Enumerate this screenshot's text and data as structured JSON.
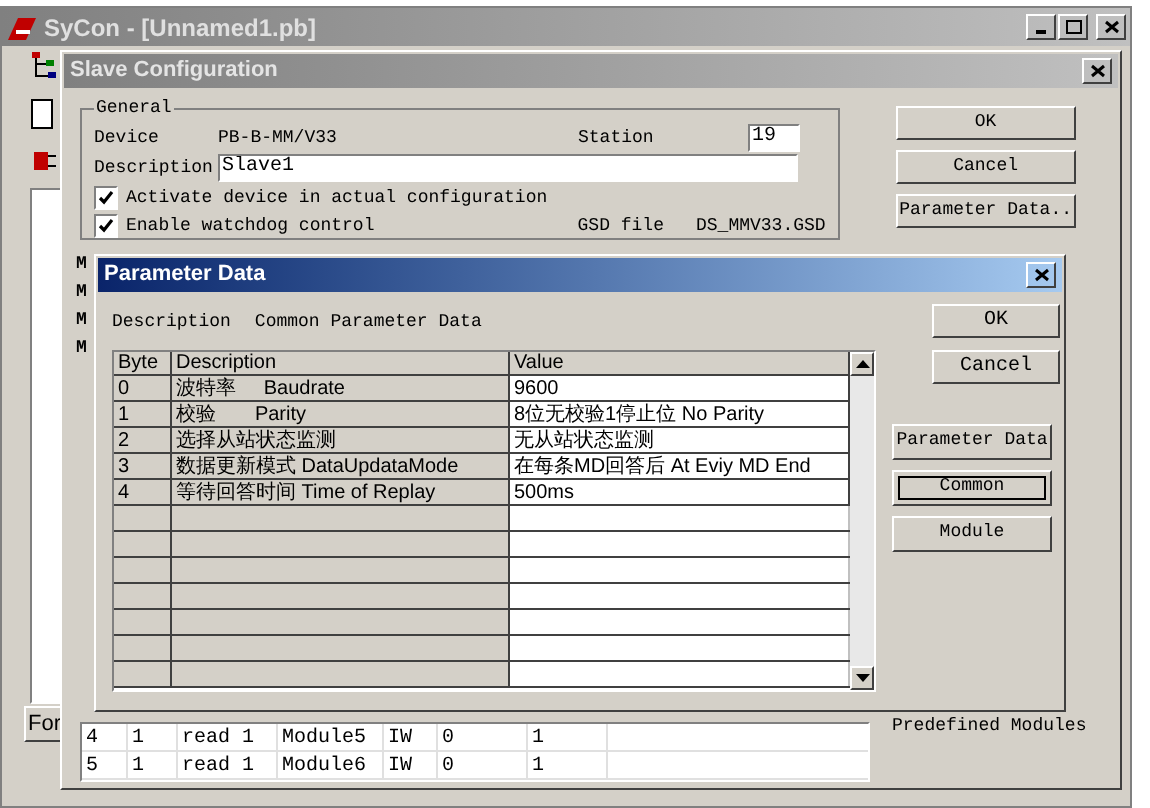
{
  "main_window": {
    "title": "SyCon - [Unnamed1.pb]",
    "tab": "For"
  },
  "slave_configuration": {
    "title": "Slave Configuration",
    "group": "General",
    "device_label": "Device",
    "device": "PB-B-MM/V33",
    "station_label": "Station",
    "station": "19",
    "description_label": "Description",
    "description": "Slave1",
    "options": [
      {
        "label": "Activate device in actual configuration",
        "checked": true
      },
      {
        "label": "Enable watchdog control",
        "checked": true
      }
    ],
    "gsd_label": "GSD file",
    "gsd_file": "DS_MMV33.GSD",
    "buttons": [
      "OK",
      "Cancel",
      "Parameter Data.."
    ],
    "side_labels": [
      "M",
      "M",
      "M",
      "M"
    ],
    "module_rows": [
      [
        "4",
        "1",
        "read 1",
        "Module5",
        "IW",
        "0",
        "1"
      ],
      [
        "5",
        "1",
        "read 1",
        "Module6",
        "IW",
        "0",
        "1"
      ]
    ],
    "predefined_label": "Predefined Modules"
  },
  "parameter_data": {
    "title": "Parameter Data",
    "description_label": "Description",
    "description": "Common Parameter Data",
    "columns": [
      "Byte",
      "Description",
      "Value"
    ],
    "rows": [
      [
        "0",
        "波特率     Baudrate",
        "9600"
      ],
      [
        "1",
        "校验       Parity",
        "8位无校验1停止位 No Parity"
      ],
      [
        "2",
        "选择从站状态监测",
        "无从站状态监测"
      ],
      [
        "3",
        "数据更新模式 DataUpdataMode",
        "在每条MD回答后 At Eviy MD End"
      ],
      [
        "4",
        "等待回答时间 Time of Replay",
        "500ms"
      ]
    ],
    "buttons": [
      {
        "label": "OK",
        "selected": false
      },
      {
        "label": "Cancel",
        "selected": false
      }
    ],
    "tabs": [
      {
        "label": "Parameter Data",
        "selected": false
      },
      {
        "label": "Common",
        "selected": true
      },
      {
        "label": "Module",
        "selected": false
      }
    ]
  }
}
